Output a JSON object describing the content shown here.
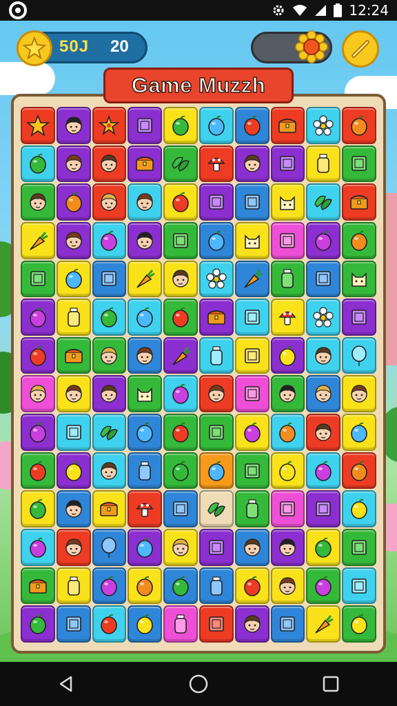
{
  "status_bar": {
    "time": "12:24"
  },
  "hud": {
    "score": "50J",
    "moves": "20"
  },
  "title": "Game Muzzh",
  "tile_colors": {
    "R": "#ee3b24",
    "O": "#f79a1b",
    "Y": "#f9e21a",
    "G": "#35b93a",
    "C": "#3fd2ee",
    "B": "#2f86d8",
    "P": "#8b2fd0",
    "M": "#ee4fd6",
    "T": "#efdcb6"
  },
  "board": [
    [
      "R:star",
      "P:face",
      "R:starfruit",
      "P:box",
      "Y:fruit",
      "C:fruit",
      "B:fruit",
      "R:chest",
      "C:flower",
      "R:fruit"
    ],
    [
      "C:fruit",
      "P:face",
      "R:face",
      "P:chest",
      "G:leaf",
      "R:mushroom",
      "P:face",
      "P:box",
      "Y:bottle",
      "G:box"
    ],
    [
      "G:face",
      "P:fruit",
      "R:face",
      "C:face",
      "Y:fruit",
      "P:box",
      "B:box",
      "Y:cat",
      "C:leaf",
      "R:chest"
    ],
    [
      "Y:carrot",
      "P:face",
      "C:fruit",
      "P:face",
      "G:box",
      "B:fruit",
      "Y:cat",
      "M:box",
      "P:fruit",
      "G:fruit"
    ],
    [
      "G:box",
      "Y:fruit",
      "B:box",
      "Y:carrot",
      "Y:face",
      "C:flower",
      "B:carrot",
      "G:bottle",
      "B:box",
      "G:cat"
    ],
    [
      "P:fruit",
      "Y:bottle",
      "C:fruit",
      "C:fruit",
      "G:fruit",
      "P:chest",
      "C:box",
      "Y:mushroom",
      "C:flower",
      "P:box"
    ],
    [
      "P:fruit",
      "G:chest",
      "G:face",
      "B:face",
      "P:carrot",
      "C:bottle",
      "Y:box",
      "P:fruit",
      "C:face",
      "C:balloon"
    ],
    [
      "M:face",
      "Y:face",
      "P:face",
      "G:cat",
      "C:fruit",
      "R:face",
      "M:box",
      "G:face",
      "B:face",
      "Y:face"
    ],
    [
      "P:fruit",
      "C:box",
      "C:leaf",
      "B:fruit",
      "G:fruit",
      "G:box",
      "Y:fruit",
      "C:fruit",
      "R:face",
      "Y:fruit"
    ],
    [
      "G:fruit",
      "P:fruit",
      "C:face",
      "B:bottle",
      "G:fruit",
      "O:fruit",
      "G:box",
      "Y:fruit",
      "C:fruit",
      "R:fruit"
    ],
    [
      "Y:fruit",
      "B:face",
      "Y:chest",
      "R:mushroom",
      "B:box",
      "T:leaf",
      "G:bottle",
      "M:box",
      "P:box",
      "C:fruit"
    ],
    [
      "C:fruit",
      "R:face",
      "B:balloon",
      "P:fruit",
      "Y:face",
      "P:box",
      "B:face",
      "P:face",
      "Y:fruit",
      "G:box"
    ],
    [
      "G:chest",
      "Y:bottle",
      "B:fruit",
      "Y:fruit",
      "B:fruit",
      "B:bottle",
      "Y:fruit",
      "Y:face",
      "G:fruit",
      "C:box"
    ],
    [
      "P:fruit",
      "B:box",
      "C:fruit",
      "B:fruit",
      "M:bottle",
      "R:box",
      "P:face",
      "B:box",
      "Y:carrot",
      "G:fruit"
    ]
  ]
}
